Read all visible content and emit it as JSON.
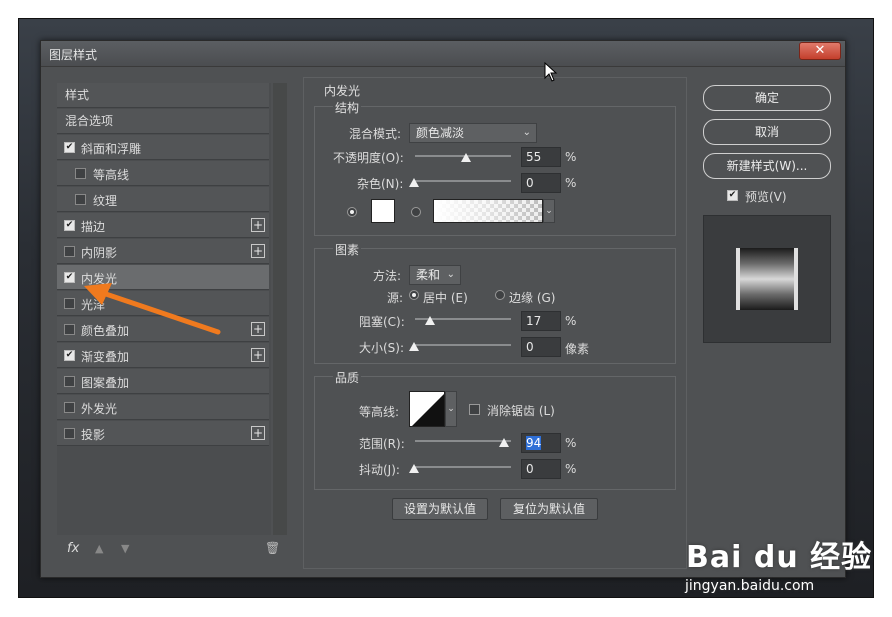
{
  "window": {
    "title": "图层样式",
    "close": "✕"
  },
  "style_list": [
    {
      "label": "样式",
      "type": "plain"
    },
    {
      "label": "混合选项",
      "type": "plain"
    },
    {
      "label": "斜面和浮雕",
      "checked": true,
      "indent": false,
      "plus": false
    },
    {
      "label": "等高线",
      "checked": false,
      "indent": true,
      "plus": false
    },
    {
      "label": "纹理",
      "checked": false,
      "indent": true,
      "plus": false
    },
    {
      "label": "描边",
      "checked": true,
      "indent": false,
      "plus": true
    },
    {
      "label": "内阴影",
      "checked": false,
      "indent": false,
      "plus": true
    },
    {
      "label": "内发光",
      "checked": true,
      "indent": false,
      "plus": false,
      "active": true
    },
    {
      "label": "光泽",
      "checked": false,
      "indent": false,
      "plus": false
    },
    {
      "label": "颜色叠加",
      "checked": false,
      "indent": false,
      "plus": true
    },
    {
      "label": "渐变叠加",
      "checked": true,
      "indent": false,
      "plus": true
    },
    {
      "label": "图案叠加",
      "checked": false,
      "indent": false,
      "plus": false
    },
    {
      "label": "外发光",
      "checked": false,
      "indent": false,
      "plus": false
    },
    {
      "label": "投影",
      "checked": false,
      "indent": false,
      "plus": true
    }
  ],
  "footer": {
    "fx": "fx"
  },
  "panel": {
    "title": "内发光",
    "structure": {
      "title": "结构",
      "blend_mode_label": "混合模式:",
      "blend_mode_value": "颜色减淡",
      "opacity_label": "不透明度(O):",
      "opacity_value": "55",
      "opacity_unit": "%",
      "noise_label": "杂色(N):",
      "noise_value": "0",
      "noise_unit": "%"
    },
    "elements": {
      "title": "图素",
      "technique_label": "方法:",
      "technique_value": "柔和",
      "source_label": "源:",
      "source_center": "居中 (E)",
      "source_edge": "边缘 (G)",
      "choke_label": "阻塞(C):",
      "choke_value": "17",
      "choke_unit": "%",
      "size_label": "大小(S):",
      "size_value": "0",
      "size_unit": "像素"
    },
    "quality": {
      "title": "品质",
      "contour_label": "等高线:",
      "antialias_label": "消除锯齿 (L)",
      "range_label": "范围(R):",
      "range_value": "94",
      "range_unit": "%",
      "jitter_label": "抖动(J):",
      "jitter_value": "0",
      "jitter_unit": "%"
    },
    "buttons": {
      "set_default": "设置为默认值",
      "reset_default": "复位为默认值"
    }
  },
  "right": {
    "ok": "确定",
    "cancel": "取消",
    "new_style": "新建样式(W)...",
    "preview_label": "预览(V)"
  },
  "watermark": {
    "logo": "Bai du 经验",
    "url": "jingyan.baidu.com"
  },
  "colors": {
    "accent_arrow": "#f07a1e",
    "selection": "#2f6fd6"
  }
}
